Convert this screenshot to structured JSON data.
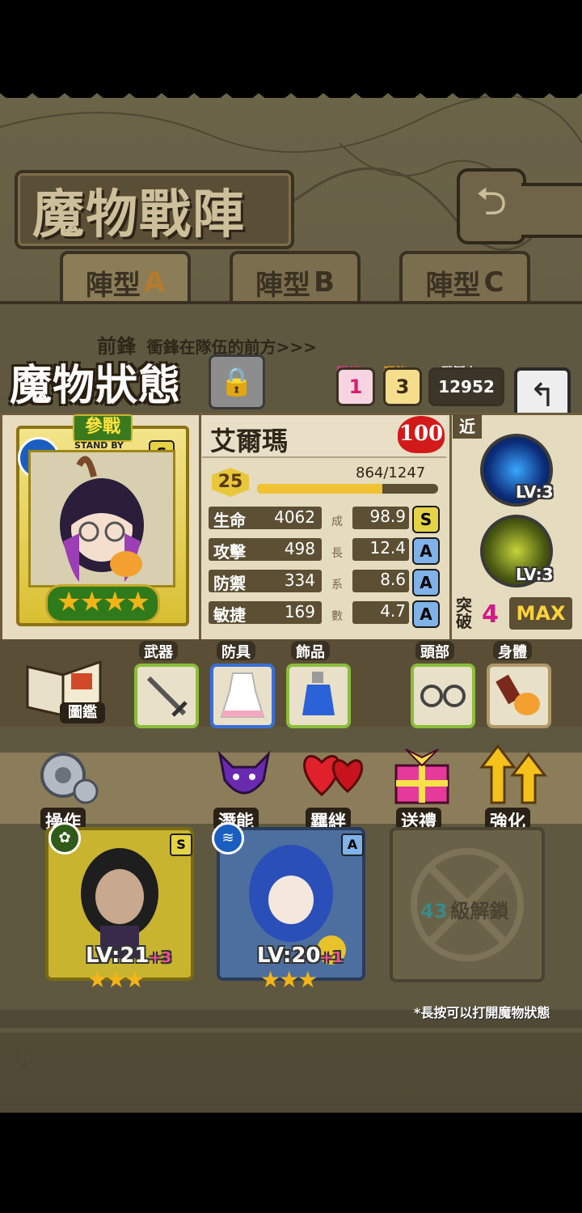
{
  "header": {
    "title": "魔物戰陣",
    "back_icon": "return-arrow-icon"
  },
  "tabs": [
    {
      "prefix": "陣型",
      "letter": "A",
      "selected": true
    },
    {
      "prefix": "陣型",
      "letter": "B",
      "selected": false
    },
    {
      "prefix": "陣型",
      "letter": "C",
      "selected": false
    }
  ],
  "formation": {
    "vanguard_label": "前鋒",
    "vanguard_hint": "衝鋒在隊伍的前方>>>"
  },
  "status": {
    "title": "魔物狀態",
    "bond_label": "羈絆",
    "bond_value": "1",
    "potential_label": "潛能",
    "potential_value": "3",
    "power_label": "戰鬥力",
    "power_value": "12952"
  },
  "character": {
    "name": "艾爾瑪",
    "affection": "100",
    "stand_by": "參戰",
    "stand_by_en": "STAND BY",
    "rank": "S",
    "stars": "★★★★",
    "level": "25",
    "exp": "864/1247",
    "exp_progress": 0.69,
    "stats": [
      {
        "label": "生命",
        "value": "4062",
        "growth": "98.9",
        "grade": "S"
      },
      {
        "label": "攻擊",
        "value": "498",
        "growth": "12.4",
        "grade": "A"
      },
      {
        "label": "防禦",
        "value": "334",
        "growth": "8.6",
        "grade": "A"
      },
      {
        "label": "敏捷",
        "value": "169",
        "growth": "4.7",
        "grade": "A"
      }
    ],
    "growth_chars": [
      "成",
      "長",
      "系",
      "數"
    ]
  },
  "skills": {
    "range": "近",
    "items": [
      {
        "level": "LV:3"
      },
      {
        "level": "LV:3"
      }
    ],
    "breakthrough_label": [
      "突",
      "破"
    ],
    "breakthrough_value": "4",
    "max_label": "MAX"
  },
  "equipment": {
    "book_label": "圖鑑",
    "slots": [
      {
        "label": "武器",
        "icon": "sword-icon"
      },
      {
        "label": "防具",
        "icon": "dress-icon"
      },
      {
        "label": "飾品",
        "icon": "potion-icon"
      },
      {
        "label": "頭部",
        "icon": "glasses-icon"
      },
      {
        "label": "身體",
        "icon": "gauntlet-icon"
      }
    ]
  },
  "actions": [
    {
      "label": "操作",
      "icon": "gear-icon"
    },
    {
      "label": "潛能",
      "icon": "demon-icon"
    },
    {
      "label": "羈絆",
      "icon": "hearts-icon"
    },
    {
      "label": "送禮",
      "icon": "gift-icon"
    },
    {
      "label": "強化",
      "icon": "arrows-up-icon"
    }
  ],
  "monsters": [
    {
      "level": "LV:21",
      "bonus": "+3",
      "rank": "S",
      "stars": "★★★"
    },
    {
      "level": "LV:20",
      "bonus": "+1",
      "rank": "A",
      "stars": "★★★"
    }
  ],
  "locked_slot": {
    "level": "43",
    "text": "級解鎖"
  },
  "hint": "*長按可以打開魔物狀態"
}
